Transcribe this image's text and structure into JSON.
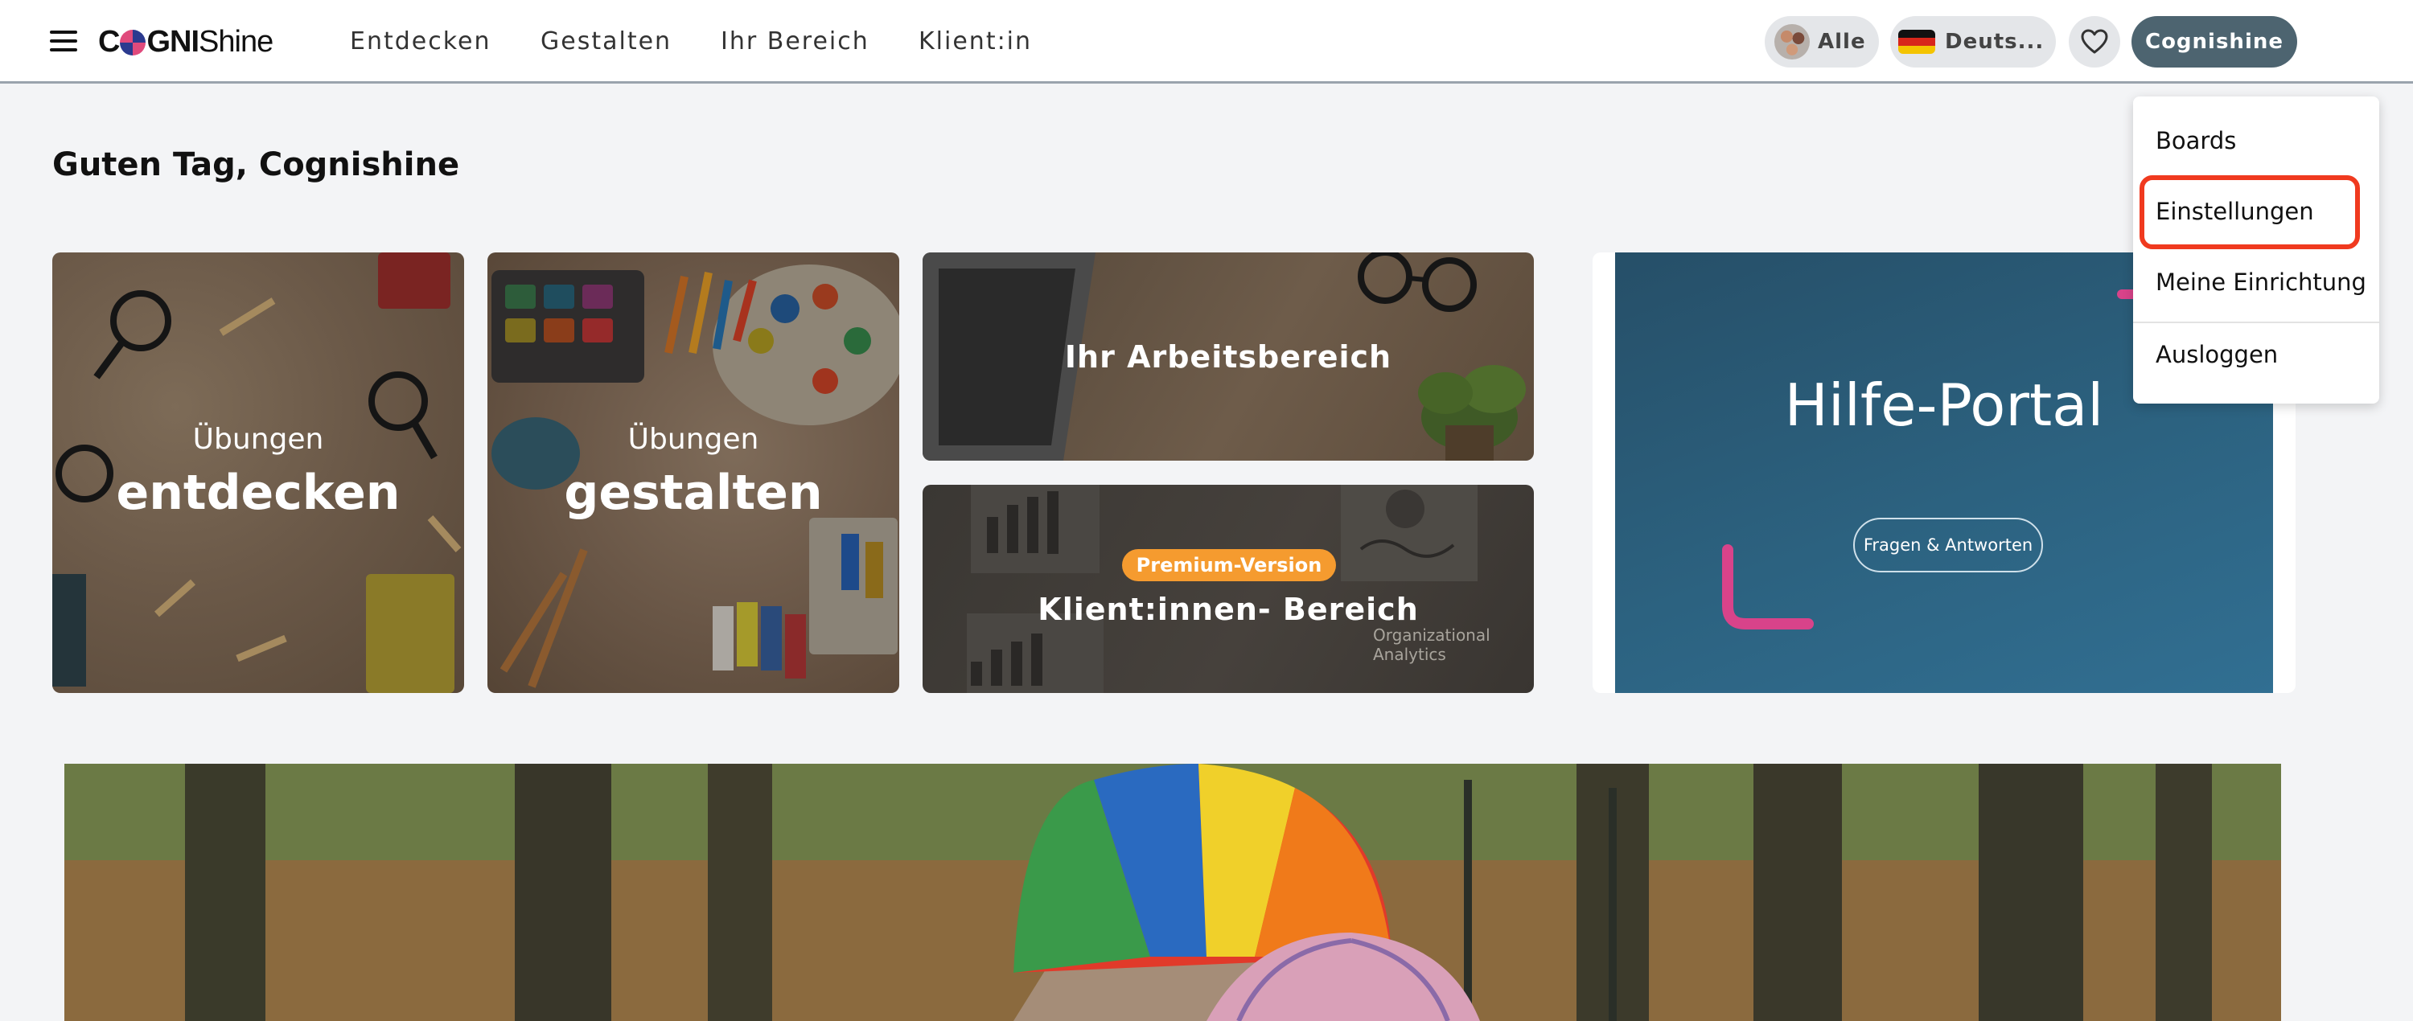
{
  "header": {
    "brand": {
      "bold_left": "C",
      "bold_right": "GNI",
      "light": "Shine"
    },
    "nav": [
      "Entdecken",
      "Gestalten",
      "Ihr Bereich",
      "Klient:in"
    ],
    "audience_pill": "Alle",
    "language_pill": "Deuts...",
    "user_pill": "Cognishine"
  },
  "greeting": "Guten Tag, Cognishine",
  "tiles": {
    "explore": {
      "small": "Übungen",
      "big": "entdecken"
    },
    "create": {
      "small": "Übungen",
      "big": "gestalten"
    },
    "workspace": {
      "title": "Ihr Arbeitsbereich"
    },
    "clients": {
      "badge": "Premium-Version",
      "title": "Klient:innen- Bereich",
      "bg_text_1": "Organizational",
      "bg_text_2": "Analytics"
    }
  },
  "help": {
    "title": "Hilfe-Portal",
    "button": "Fragen & Antworten"
  },
  "user_menu": {
    "items": [
      "Boards",
      "Einstellungen",
      "Meine Einrichtung",
      "Ausloggen"
    ],
    "highlighted": "Einstellungen"
  },
  "colors": {
    "user_pill": "#4d6470",
    "badge": "#f59b2f",
    "help_bg": "#2c6280",
    "accent_pink": "#d8438a",
    "highlight": "#f03a1f"
  },
  "icons": [
    "menu-icon",
    "audience-icon",
    "germany-flag-icon",
    "heart-icon"
  ]
}
